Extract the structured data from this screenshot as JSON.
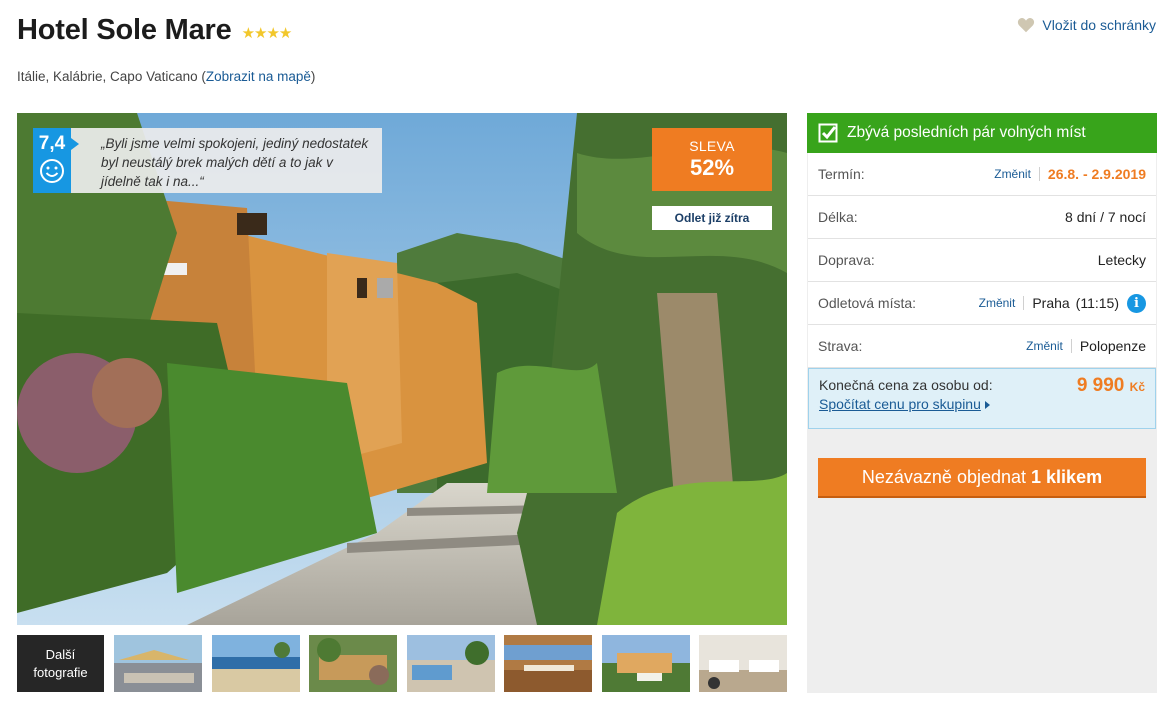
{
  "hotel": {
    "name": "Hotel Sole Mare",
    "stars": "★★★★",
    "location": "Itálie, Kalábrie, Capo Vaticano",
    "map_link": "Zobrazit na mapě"
  },
  "favorite": {
    "label": "Vložit do schránky",
    "icon": "heart-icon"
  },
  "rating": {
    "score": "7,4",
    "icon": "smiley-icon",
    "review": "„Byli jsme velmi spokojeni, jediný nedostatek byl neustálý brek malých dětí a to jak v jídelně tak i na...“"
  },
  "discount": {
    "label": "SLEVA",
    "value": "52%"
  },
  "departure_badge": "Odlet již zítra",
  "thumbnails": {
    "more_line1": "Další",
    "more_line2": "fotografie",
    "items": [
      "beach-bar",
      "beach",
      "terrace",
      "pool-area",
      "restaurant",
      "hotel-exterior",
      "dining-room"
    ]
  },
  "sidebar": {
    "alert": "Zbývá posledních pár volných míst",
    "rows": [
      {
        "label": "Termín:",
        "change": "Změnit",
        "value": "26.8. - 2.9.2019"
      },
      {
        "label": "Délka:",
        "value": "8 dní / 7 nocí"
      },
      {
        "label": "Doprava:",
        "value": "Letecky"
      },
      {
        "label": "Odletová místa:",
        "change": "Změnit",
        "value": "Praha",
        "time": "(11:15)",
        "info": "i"
      },
      {
        "label": "Strava:",
        "change": "Změnit",
        "value": "Polopenze"
      }
    ],
    "price": {
      "label": "Konečná cena za osobu od:",
      "amount": "9 990",
      "currency": "Kč",
      "group_link": "Spočítat cenu pro skupinu"
    },
    "order": {
      "text": "Nezávazně objednat",
      "bold": "1 klikem"
    }
  },
  "colors": {
    "accent": "#ef7c22",
    "green": "#38a41b",
    "blue": "#1797e2",
    "link": "#1a5b95"
  }
}
